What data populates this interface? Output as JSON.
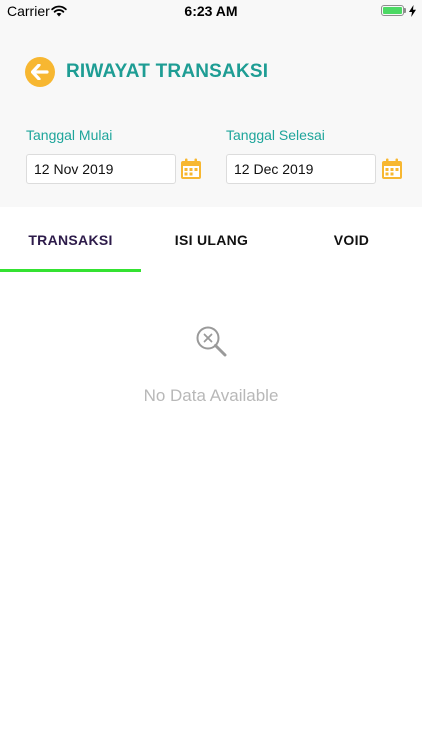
{
  "status_bar": {
    "carrier": "Carrier",
    "time": "6:23 AM",
    "battery_color": "#4cd964"
  },
  "header": {
    "title": "RIWAYAT TRANSAKSI",
    "back_icon": "arrow-left-icon",
    "accent_color": "#1e9d94",
    "back_color": "#f7b731"
  },
  "filters": {
    "start": {
      "label": "Tanggal Mulai",
      "value": "12 Nov 2019",
      "icon": "calendar-icon"
    },
    "end": {
      "label": "Tanggal Selesai",
      "value": "12 Dec 2019",
      "icon": "calendar-icon"
    }
  },
  "tabs": [
    {
      "label": "TRANSAKSI",
      "active": true
    },
    {
      "label": "ISI ULANG",
      "active": false
    },
    {
      "label": "VOID",
      "active": false
    }
  ],
  "tab_indicator_color": "#34e231",
  "empty_state": {
    "icon": "search-close-icon",
    "text": "No Data Available"
  }
}
